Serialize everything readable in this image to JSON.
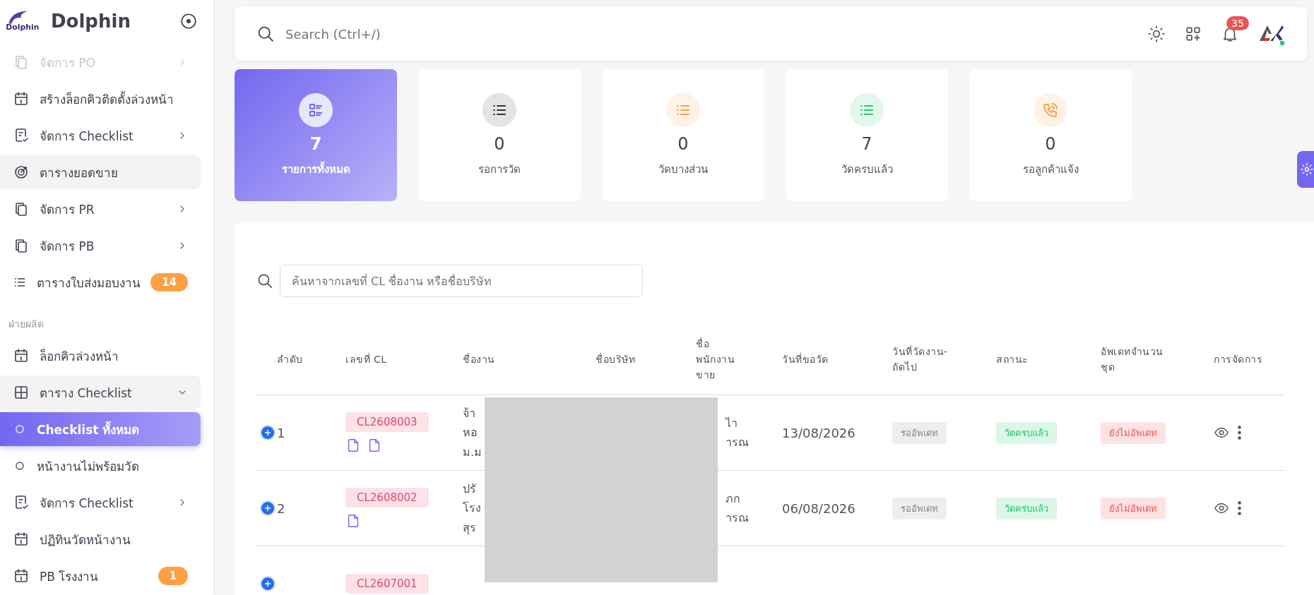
{
  "brand": {
    "name": "Dolphin",
    "logo_text": "Dolphin"
  },
  "sidebar": {
    "items": [
      {
        "kind": "item",
        "label": "จัดการ PO",
        "expanded": false,
        "dimmed": true
      },
      {
        "kind": "item",
        "label": "สร้างล็อกคิวติดตั้งล่วงหน้า"
      },
      {
        "kind": "item",
        "label": "จัดการ Checklist",
        "expanded": false
      },
      {
        "kind": "item",
        "label": "ตารางยอดขาย",
        "highlighted": true
      },
      {
        "kind": "item",
        "label": "จัดการ PR",
        "expanded": false
      },
      {
        "kind": "item",
        "label": "จัดการ PB",
        "expanded": false
      },
      {
        "kind": "item",
        "label": "ตารางใบส่งมอบงาน",
        "badge": "14"
      },
      {
        "kind": "section",
        "label": "ฝ่ายผลิต"
      },
      {
        "kind": "item",
        "label": "ล็อกคิวล่วงหน้า"
      },
      {
        "kind": "item",
        "label": "ตาราง Checklist",
        "expanded": true,
        "highlighted": true,
        "children": [
          {
            "label": "Checklist ทั้งหมด",
            "selected": true
          },
          {
            "label": "หน้างานไม่พร้อมวัด",
            "selected": false
          }
        ]
      },
      {
        "kind": "item",
        "label": "จัดการ Checklist",
        "expanded": false
      },
      {
        "kind": "item",
        "label": "ปฏิทินวัดหน้างาน"
      },
      {
        "kind": "item",
        "label": "PB โรงงาน",
        "badge": "1"
      }
    ]
  },
  "topbar": {
    "search": {
      "placeholder": "Search (Ctrl+/)"
    },
    "notifications": "35"
  },
  "stats": [
    {
      "value": "7",
      "label": "รายการทั้งหมด",
      "selected": true,
      "color": "#7367f0"
    },
    {
      "value": "0",
      "label": "รอการวัด",
      "selected": false,
      "color": "#333333"
    },
    {
      "value": "0",
      "label": "วัดบางส่วน",
      "selected": false,
      "color": "#ff9f43"
    },
    {
      "value": "7",
      "label": "วัดครบแล้ว",
      "selected": false,
      "color": "#28c76f"
    },
    {
      "value": "0",
      "label": "รอลูกค้าแจ้ง",
      "selected": false,
      "color": "#ff9f43"
    }
  ],
  "table": {
    "search": {
      "placeholder": "ค้นหาจากเลขที่ CL ชื่องาน หรือชื่อบริษัท"
    },
    "columns": [
      "ลำดับ",
      "เลขที่ CL",
      "ชื่องาน",
      "ชื่อบริษัท",
      "ชื่อ\nพนักงาน\nขาย",
      "วันที่ขอวัด",
      "วันที่วัดงาน-\nถัดไป",
      "สถานะ",
      "อัพเดทจำนวน\nชุด",
      "การจัดการ"
    ],
    "rows": [
      {
        "index": "1",
        "cl": "CL2608003",
        "attachments": [
          {
            "kind": "file"
          },
          {
            "kind": "file"
          }
        ],
        "job": "จ้า\nหอ\nม.ม",
        "sales": "ไา\nารณ",
        "date": "13/08/2026",
        "next": {
          "text": "รออัพเดท",
          "kind": "pending"
        },
        "status": {
          "text": "วัดครบแล้ว",
          "kind": "done"
        },
        "update": {
          "text": "ยังไม่อัพเดท",
          "kind": "missing"
        }
      },
      {
        "index": "2",
        "cl": "CL2608002",
        "attachments": [
          {
            "kind": "file"
          }
        ],
        "job": "ปรั\nโรง\nสุร",
        "sales": "ภก\nารณ",
        "date": "06/08/2026",
        "next": {
          "text": "รออัพเดท",
          "kind": "pending"
        },
        "status": {
          "text": "วัดครบแล้ว",
          "kind": "done"
        },
        "update": {
          "text": "ยังไม่อัพเดท",
          "kind": "missing"
        }
      },
      {
        "index": "",
        "cl": "CL2607001",
        "attachments": []
      }
    ]
  }
}
